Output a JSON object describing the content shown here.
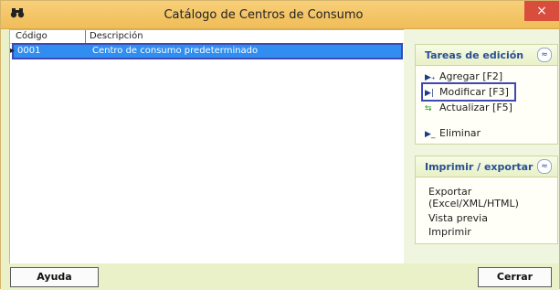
{
  "window": {
    "title": "Catálogo de Centros de Consumo",
    "icon": "binoculars-icon",
    "close_glyph": "×"
  },
  "grid": {
    "columns": [
      "Código",
      "Descripción"
    ],
    "rows": [
      {
        "code": "0001",
        "description": "Centro de consumo predeterminado",
        "selected": true
      }
    ],
    "row_indicator": "▸"
  },
  "edit_panel": {
    "title": "Tareas de edición",
    "collapse_glyph": "≈",
    "items": [
      {
        "label": "Agregar  [F2]",
        "icon": "add-icon"
      },
      {
        "label": "Modificar  [F3]",
        "icon": "edit-icon",
        "highlighted": true
      },
      {
        "label": "Actualizar [F5]",
        "icon": "refresh-icon"
      },
      {
        "label": "Eliminar",
        "icon": "delete-icon"
      }
    ]
  },
  "export_panel": {
    "title": "Imprimir / exportar",
    "collapse_glyph": "≈",
    "items": [
      {
        "label": "Exportar"
      },
      {
        "label": "(Excel/XML/HTML)"
      },
      {
        "label": "Vista previa"
      },
      {
        "label": "Imprimir"
      }
    ]
  },
  "buttons": {
    "help": "Ayuda",
    "close": "Cerrar"
  },
  "colors": {
    "title_bar": "#f0bd58",
    "selection": "#2f8ef0",
    "highlight_border": "#3f49b5",
    "close_button": "#d94d3d"
  }
}
